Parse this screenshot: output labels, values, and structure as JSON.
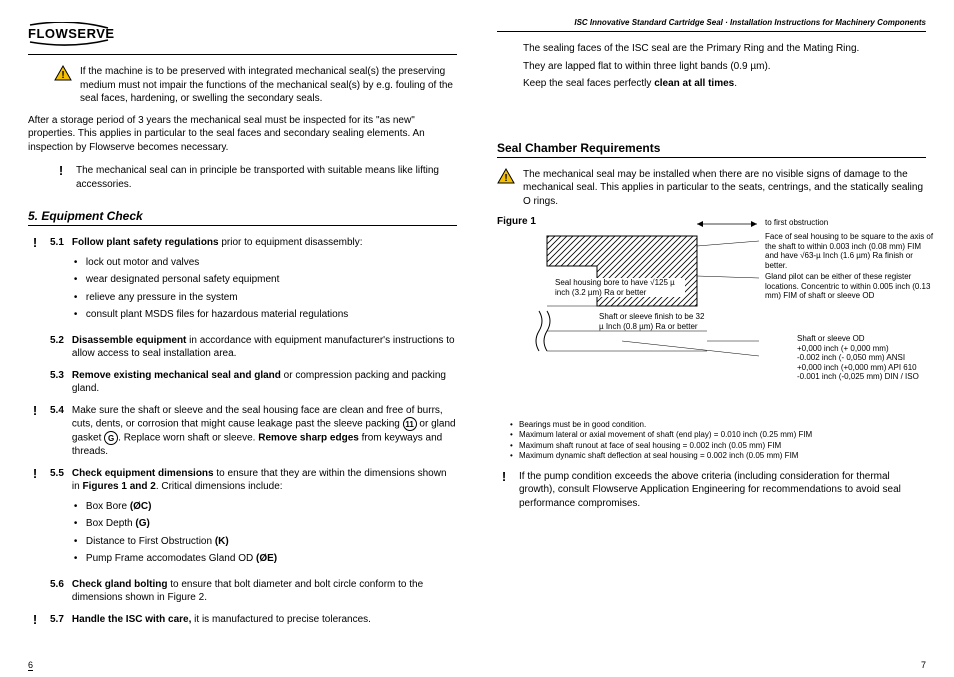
{
  "header": {
    "logo_text": "FLOWSERVE",
    "doc_title": "ISC Innovative Standard Cartridge Seal  ·  Installation Instructions for Machinery Components"
  },
  "left": {
    "warn1": "If the machine is to be preserved with integrated mechanical seal(s) the preserving medium must not impair the functions of the mechanical seal(s) by e.g. fouling of the seal faces, hardening, or swelling the secondary seals.",
    "storage_para": "After a storage period of 3 years the mechanical seal must be inspected for its \"as new\" properties. This applies in particular to the seal faces and secondary sealing elements. An inspection by Flowserve becomes necessary.",
    "excl1": "The mechanical seal can in principle be transported with suitable means like lifting accessories.",
    "section5_title": "5.   Equipment Check",
    "s51_lead": "Follow plant safety regulations",
    "s51_rest": " prior to equipment disassembly:",
    "s51_b1": "lock out motor and valves",
    "s51_b2": "wear designated personal safety equipment",
    "s51_b3": "relieve any pressure in the system",
    "s51_b4": "consult plant MSDS files for hazardous material regulations",
    "s52_lead": "Disassemble equipment",
    "s52_rest": " in accordance with equipment manufacturer's instructions to allow access to seal installation area.",
    "s53_lead": "Remove existing mechanical seal and gland",
    "s53_rest": " or compression packing and packing gland.",
    "s54_a": "Make sure the shaft or sleeve and the seal housing face are clean and free of burrs, cuts, dents, or corrosion that might cause leakage past the sleeve packing ",
    "s54_circ1": "11",
    "s54_b": " or gland gasket ",
    "s54_circ2": "G",
    "s54_c": ".  Replace worn shaft or sleeve. ",
    "s54_bold": "Remove sharp edges",
    "s54_d": " from keyways and threads.",
    "s55_lead": "Check equipment dimensions",
    "s55_rest": " to ensure that they are within the dimensions shown in ",
    "s55_bold": "Figures 1 and 2",
    "s55_rest2": ". Critical dimensions include:",
    "s55_b1": "Box Bore ",
    "s55_b1_bold": "(ØC)",
    "s55_b2": "Box Depth ",
    "s55_b2_bold": "(G)",
    "s55_b3": "Distance to First Obstruction ",
    "s55_b3_bold": "(K)",
    "s55_b4": "Pump Frame accomodates Gland OD ",
    "s55_b4_bold": "(ØE)",
    "s56_lead": "Check gland bolting",
    "s56_rest": " to ensure that bolt diameter and bolt circle conform to the dimensions shown in Figure 2.",
    "s57_lead": "Handle the ISC with care,",
    "s57_rest": " it is manufactured to precise tolerances.",
    "page_num": "6"
  },
  "right": {
    "p1": "The sealing faces of the ISC seal are the Primary Ring and the Mating Ring.",
    "p2": "They are lapped flat to within three light bands (0.9 µm).",
    "p3_a": "Keep the seal faces perfectly ",
    "p3_bold": "clean at all times",
    "p3_b": ".",
    "scr_title": "Seal Chamber Requirements",
    "scr_warn": "The mechanical seal may be installed when there are no visible signs of damage to the mechanical seal. This applies in particular to the seats, centrings, and the statically sealing O rings.",
    "fig_label": "Figure  1",
    "c_obstruction": "to first  obstruction",
    "c_face": "Face of seal housing to be square to the axis of the shaft to within 0.003 inch (0.08 mm) FIM and have √63-µ Inch (1.6 µm) Ra finish or better.",
    "c_gland": "Gland pilot can be either of these register locations. Concentric to within 0.005 inch (0.13 mm) FIM of shaft or sleeve OD",
    "c_bore": "Seal housing bore to have √125 µ inch (3.2 µm) Ra or better",
    "c_shaftfinish": "Shaft or sleeve finish to be 32 µ Inch (0.8 µm) Ra or better",
    "c_shaftod_label": "Shaft or sleeve OD",
    "c_shaftod_l1": "+0,000 inch  (+ 0,000 mm)",
    "c_shaftod_l2": "-0.002 inch  (- 0,050 mm)  ANSI",
    "c_shaftod_l3": "+0,000 inch  (+0,000 mm)  API 610",
    "c_shaftod_l4": "-0.001 inch  (-0,025 mm)  DIN / ISO",
    "tiny1": "Bearings must be in good condition.",
    "tiny2": "Maximum lateral or axial movement of shaft (end play) = 0.010 inch (0.25 mm) FIM",
    "tiny3": "Maximum shaft runout at face of seal housing = 0.002 inch (0.05 mm) FIM",
    "tiny4": "Maximum dynamic shaft deflection at seal housing = 0.002 inch (0.05 mm) FIM",
    "excl_below": "If the pump condition exceeds the above criteria (including consideration for thermal growth), consult Flowserve Application Engineering for recommendations to avoid seal performance compromises.",
    "page_num": "7"
  }
}
